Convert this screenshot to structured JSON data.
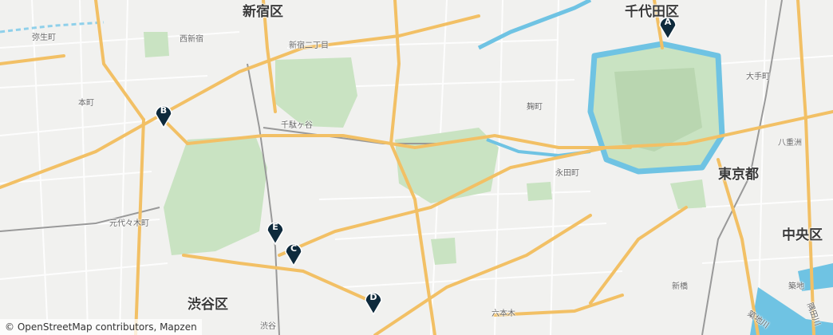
{
  "wards": {
    "shinjuku": "新宿区",
    "chiyoda": "千代田区",
    "tokyo": "東京都",
    "chuo": "中央区",
    "shibuya": "渋谷区"
  },
  "places": {
    "yayoicho": "弥生町",
    "nishishinjuku": "西新宿",
    "shinjuku_nichome": "新宿二丁目",
    "honmachi": "本町",
    "sendagaya": "千駄ヶ谷",
    "kojimachi": "麹町",
    "otemachi": "大手町",
    "yaesu": "八重洲",
    "nagatacho": "永田町",
    "motoyoyogicho": "元代々木町",
    "shinbashi": "新橋",
    "tsukiji": "築地",
    "roppongi": "六本木",
    "shibuya": "渋谷",
    "tsukijigawa": "築地川",
    "sumidagawa": "隅田川"
  },
  "markers": [
    {
      "id": "A",
      "label": "A"
    },
    {
      "id": "B",
      "label": "B"
    },
    {
      "id": "C",
      "label": "C"
    },
    {
      "id": "D",
      "label": "D"
    },
    {
      "id": "E",
      "label": "E"
    }
  ],
  "colors": {
    "land": "#f1f1ef",
    "park": "#c9e3c2",
    "water": "#6fc3e3",
    "major_road": "#f2c065",
    "marker": "#0e2a3c"
  },
  "attribution": "© OpenStreetMap contributors, Mapzen"
}
